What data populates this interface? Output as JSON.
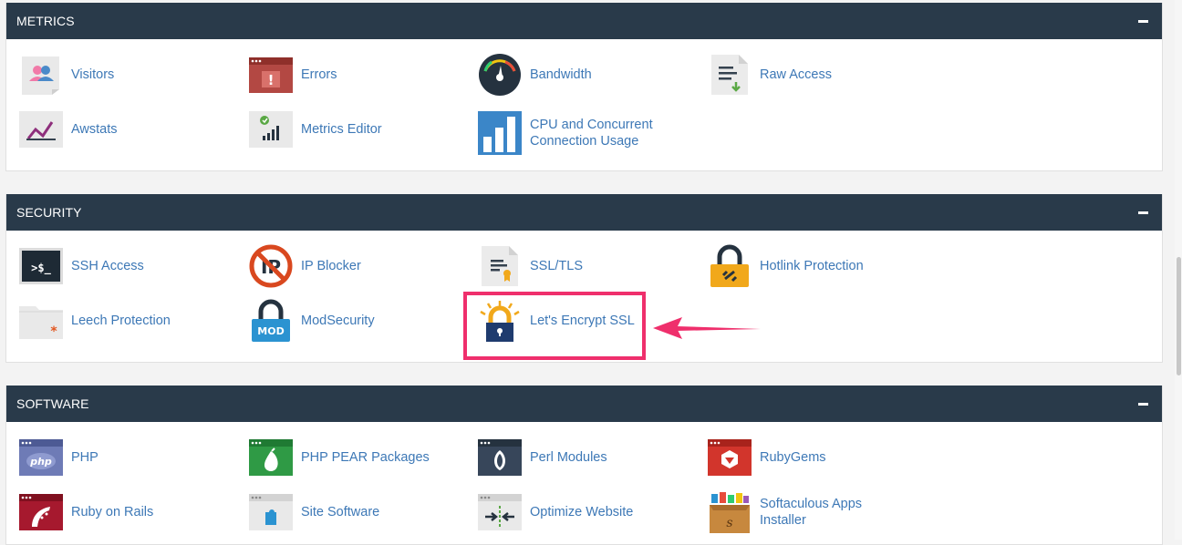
{
  "metrics": {
    "title": "METRICS",
    "items": [
      {
        "label": "Visitors",
        "icon": "visitors-icon"
      },
      {
        "label": "Errors",
        "icon": "errors-icon"
      },
      {
        "label": "Bandwidth",
        "icon": "bandwidth-icon"
      },
      {
        "label": "Raw Access",
        "icon": "raw-access-icon"
      },
      {
        "label": "Awstats",
        "icon": "awstats-icon"
      },
      {
        "label": "Metrics Editor",
        "icon": "metrics-editor-icon"
      },
      {
        "label": "CPU and Concurrent Connection Usage",
        "icon": "cpu-usage-icon"
      }
    ]
  },
  "security": {
    "title": "SECURITY",
    "items": [
      {
        "label": "SSH Access",
        "icon": "ssh-terminal-icon"
      },
      {
        "label": "IP Blocker",
        "icon": "ip-blocker-icon"
      },
      {
        "label": "SSL/TLS",
        "icon": "ssl-certificate-icon"
      },
      {
        "label": "Hotlink Protection",
        "icon": "hotlink-lock-icon"
      },
      {
        "label": "Leech Protection",
        "icon": "leech-folder-icon"
      },
      {
        "label": "ModSecurity",
        "icon": "modsecurity-lock-icon"
      },
      {
        "label": "Let's Encrypt SSL",
        "icon": "lets-encrypt-icon"
      }
    ]
  },
  "software": {
    "title": "SOFTWARE",
    "items": [
      {
        "label": "PHP",
        "icon": "php-icon"
      },
      {
        "label": "PHP PEAR Packages",
        "icon": "php-pear-icon"
      },
      {
        "label": "Perl Modules",
        "icon": "perl-onion-icon"
      },
      {
        "label": "RubyGems",
        "icon": "rubygems-icon"
      },
      {
        "label": "Ruby on Rails",
        "icon": "ruby-on-rails-icon"
      },
      {
        "label": "Site Software",
        "icon": "site-software-icon"
      },
      {
        "label": "Optimize Website",
        "icon": "optimize-website-icon"
      },
      {
        "label": "Softaculous Apps Installer",
        "icon": "softaculous-box-icon"
      }
    ]
  },
  "colors": {
    "header_bg": "#293a4a",
    "link": "#3d78b6",
    "highlight": "#ef2f6c"
  }
}
